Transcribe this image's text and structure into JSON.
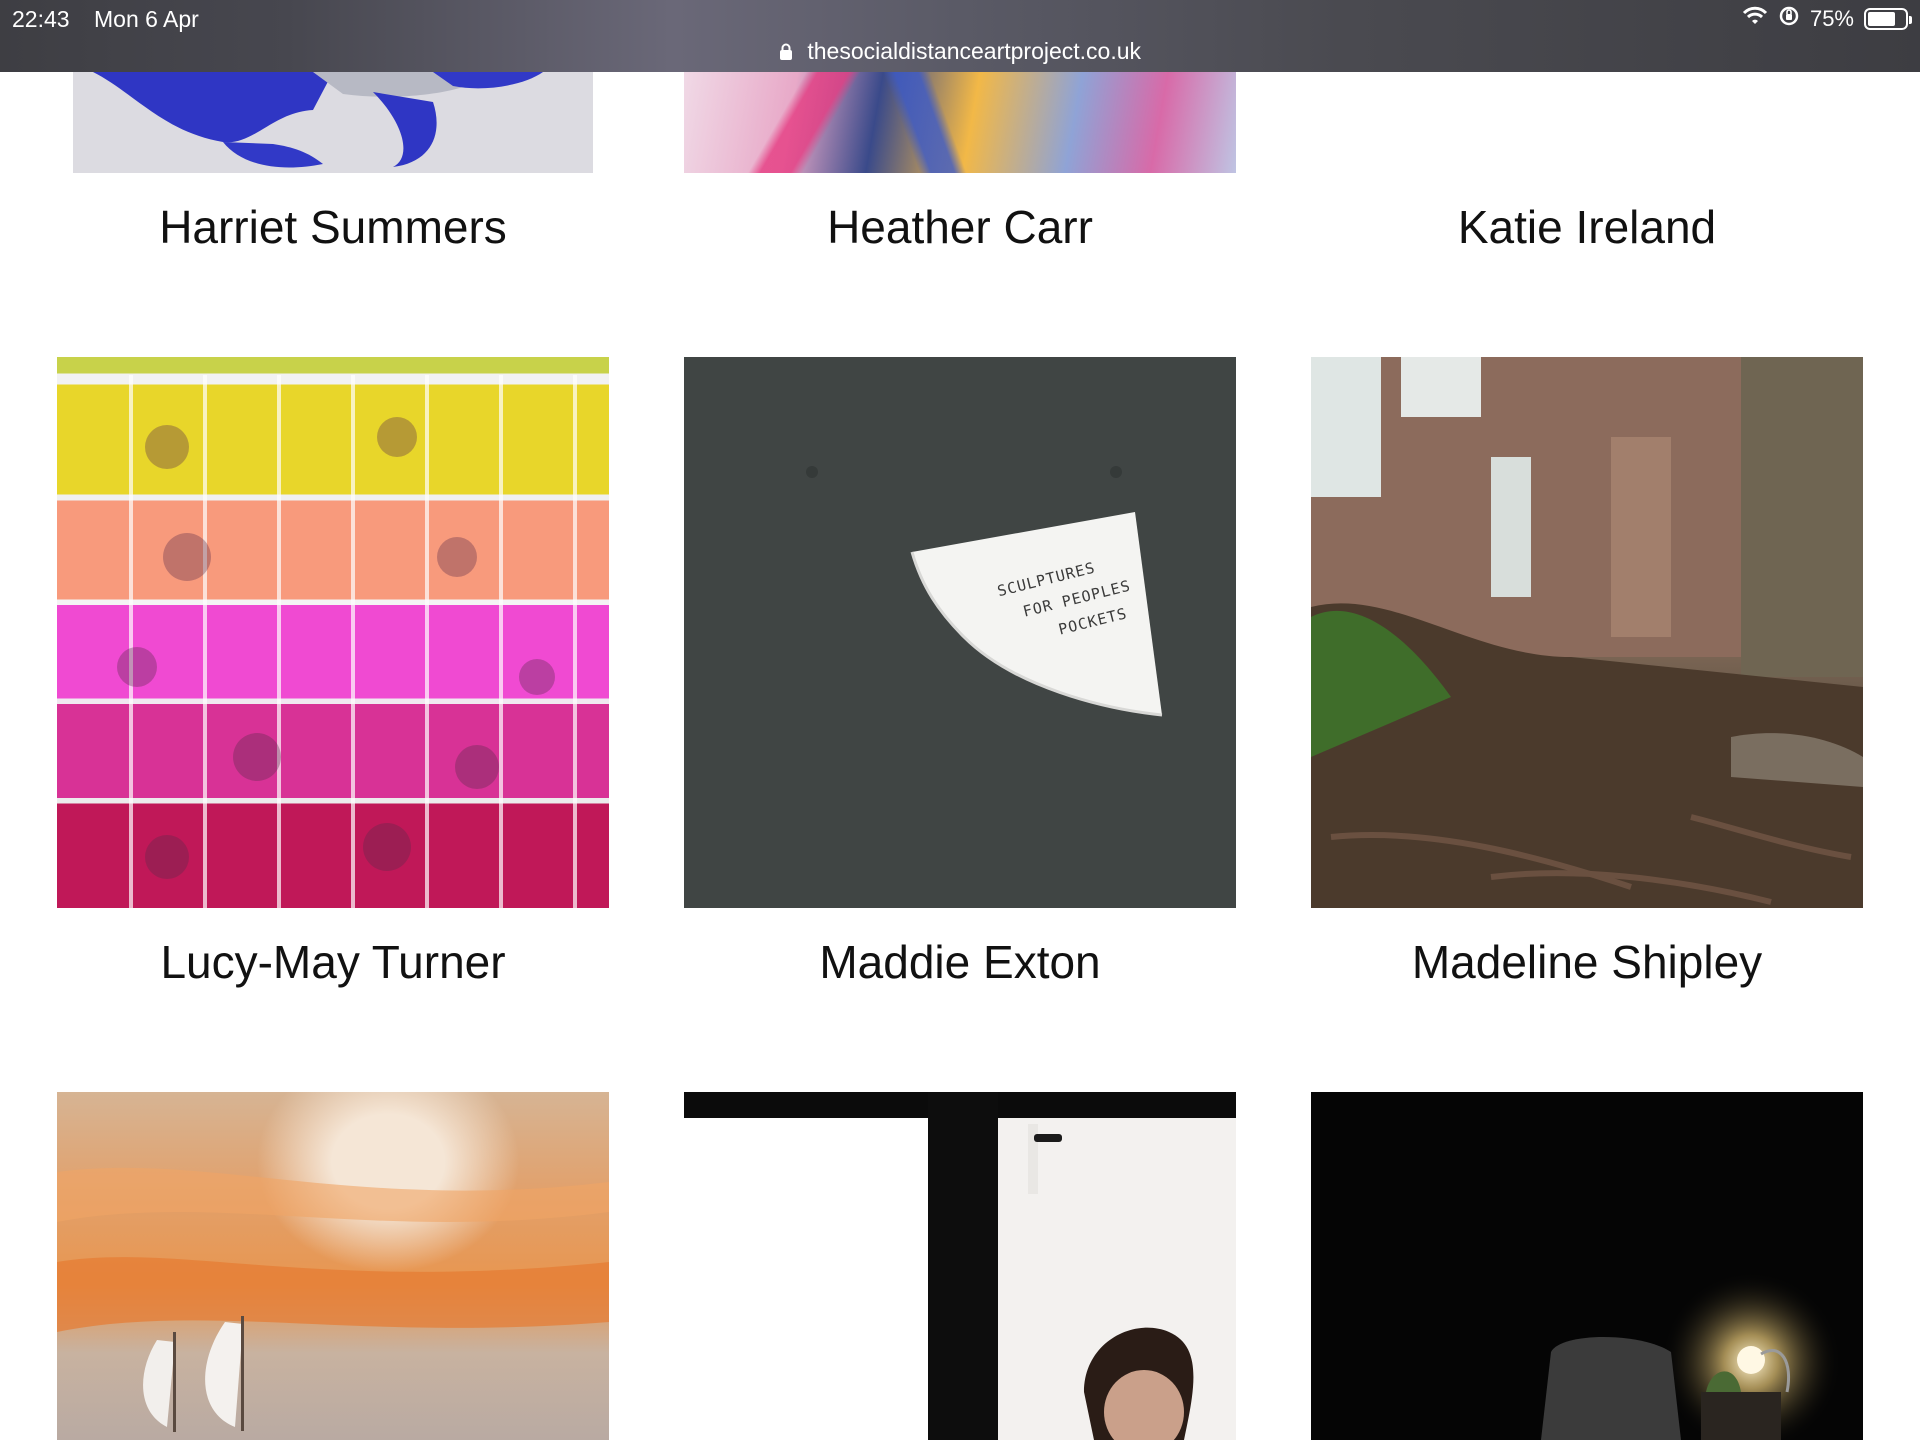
{
  "status_bar": {
    "time": "22:43",
    "date": "Mon 6 Apr",
    "battery_text": "75%",
    "battery_level": 0.75
  },
  "address_bar": {
    "url": "thesocialdistanceartproject.co.uk"
  },
  "artists": [
    {
      "name": "Harriet Summers"
    },
    {
      "name": "Heather Carr"
    },
    {
      "name": "Katie Ireland"
    },
    {
      "name": "Lucy-May Turner"
    },
    {
      "name": "Maddie Exton"
    },
    {
      "name": "Madeline Shipley"
    }
  ],
  "artwork_text": {
    "maddie_note": [
      "SCULPTURES",
      "FOR PEOPLES",
      "POCKETS"
    ]
  },
  "colors": {
    "topbar": "#47474f",
    "page_background": "#ffffff",
    "label_text": "#111111"
  }
}
